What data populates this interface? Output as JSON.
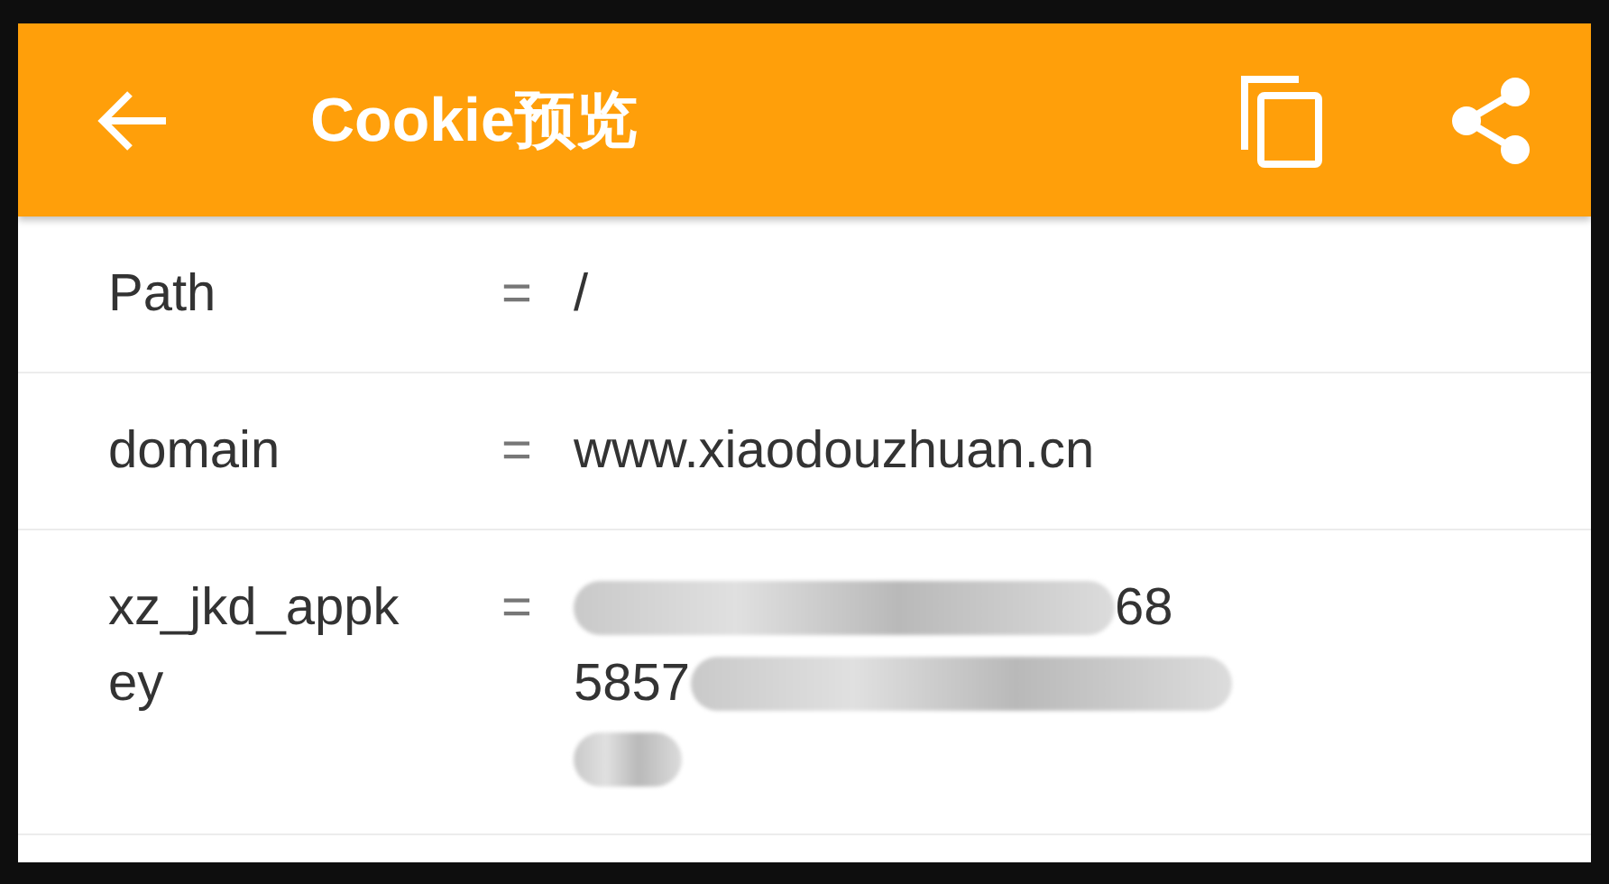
{
  "app_bar": {
    "title": "Cookie预览"
  },
  "rows": [
    {
      "name": "Path",
      "separator": "=",
      "value_lines": [
        [
          {
            "kind": "text",
            "text": "/"
          }
        ]
      ]
    },
    {
      "name": "domain",
      "separator": "=",
      "value_lines": [
        [
          {
            "kind": "text",
            "text": "www.xiaodouzhuan.cn"
          }
        ]
      ]
    },
    {
      "name": "xz_jkd_appk\ney",
      "separator": "=",
      "value_lines": [
        [
          {
            "kind": "redacted"
          },
          {
            "kind": "text",
            "text": "68"
          }
        ],
        [
          {
            "kind": "text",
            "text": "5857"
          },
          {
            "kind": "redacted"
          }
        ],
        [
          {
            "kind": "redacted"
          }
        ]
      ]
    }
  ]
}
